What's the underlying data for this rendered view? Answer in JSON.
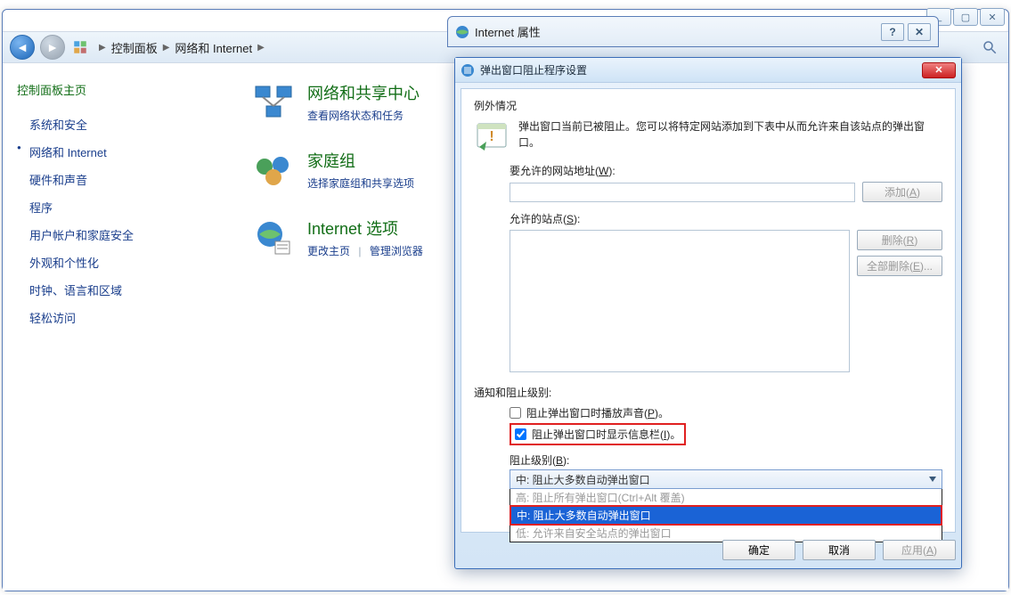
{
  "explorer": {
    "breadcrumb": [
      "控制面板",
      "网络和 Internet"
    ],
    "titlebar_tooltip": {
      "min": "_",
      "max": "▢",
      "close": "✕"
    }
  },
  "sidebar": {
    "heading": "控制面板主页",
    "items": [
      "系统和安全",
      "网络和 Internet",
      "硬件和声音",
      "程序",
      "用户帐户和家庭安全",
      "外观和个性化",
      "时钟、语言和区域",
      "轻松访问"
    ],
    "current_index": 1
  },
  "content": {
    "items": [
      {
        "title": "网络和共享中心",
        "links": [
          "查看网络状态和任务"
        ]
      },
      {
        "title": "家庭组",
        "links": [
          "选择家庭组和共享选项"
        ]
      },
      {
        "title": "Internet 选项",
        "links": [
          "更改主页",
          "管理浏览器"
        ]
      }
    ]
  },
  "inetprops": {
    "title": "Internet 属性",
    "help": "?",
    "close": "✕"
  },
  "popdlg": {
    "title": "弹出窗口阻止程序设置",
    "close": "✕",
    "exceptions_label": "例外情况",
    "info_text": "弹出窗口当前已被阻止。您可以将特定网站添加到下表中从而允许来自该站点的弹出窗口。",
    "allow_label": "要允许的网站地址(W):",
    "add_btn": "添加(A)",
    "allowed_label": "允许的站点(S):",
    "remove_btn": "删除(R)",
    "remove_all_btn": "全部删除(E)...",
    "notif_head": "通知和阻止级别:",
    "chk_sound": "阻止弹出窗口时播放声音(P)。",
    "chk_infobar": "阻止弹出窗口时显示信息栏(I)。",
    "block_level_label": "阻止级别(B):",
    "combo_value": "中: 阻止大多数自动弹出窗口",
    "options": {
      "high": "高: 阻止所有弹出窗口(Ctrl+Alt 覆盖)",
      "medium": "中: 阻止大多数自动弹出窗口",
      "low": "低: 允许来自安全站点的弹出窗口"
    },
    "footer": {
      "ok": "确定",
      "cancel": "取消",
      "apply": "应用(A)"
    },
    "checked_sound": false,
    "checked_infobar": true
  }
}
